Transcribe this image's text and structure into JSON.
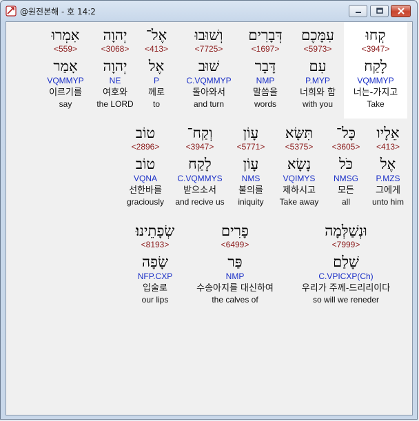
{
  "window": {
    "title": "@원전본해 - 호 14:2"
  },
  "rows": [
    [
      {
        "heb": "קְחוּ",
        "strong": "<3947>",
        "lemma": "לָקַח",
        "parse": "VQMMYP",
        "korean": "너는-가지고",
        "english": "Take",
        "selected": true
      },
      {
        "heb": "עִמָּכֶם",
        "strong": "<5973>",
        "lemma": "עִם",
        "parse": "P.MYP",
        "korean": "너희와 함",
        "english": "with you"
      },
      {
        "heb": "דְּבָרִים",
        "strong": "<1697>",
        "lemma": "דָּבָר",
        "parse": "NMP",
        "korean": "말씀을",
        "english": "words"
      },
      {
        "heb": "וְשׁוּבוּ",
        "strong": "<7725>",
        "lemma": "שׁוּב",
        "parse": "C.VQMMYP",
        "korean": "돌아와서",
        "english": "and turn"
      },
      {
        "heb": "אֶל־",
        "strong": "<413>",
        "lemma": "אֶל",
        "parse": "P",
        "korean": "께로",
        "english": "to"
      },
      {
        "heb": "יְהוָה",
        "strong": "<3068>",
        "lemma": "יְהוָה",
        "parse": "NE",
        "korean": "여호와",
        "english": "the LORD"
      },
      {
        "heb": "אִמְרוּ",
        "strong": "<559>",
        "lemma": "אָמַר",
        "parse": "VQMMYP",
        "korean": "이르기를",
        "english": "say"
      }
    ],
    [
      {
        "heb": "אֵלָיו",
        "strong": "<413>",
        "lemma": "אֶל",
        "parse": "P.MZS",
        "korean": "그에게",
        "english": "unto him"
      },
      {
        "heb": "כָּל־",
        "strong": "<3605>",
        "lemma": "כֹּל",
        "parse": "NMSG",
        "korean": "모든",
        "english": "all"
      },
      {
        "heb": "תִּשָּׂא",
        "strong": "<5375>",
        "lemma": "נָשָׂא",
        "parse": "VQIMYS",
        "korean": "제하시고",
        "english": "Take away"
      },
      {
        "heb": "עָוֹן",
        "strong": "<5771>",
        "lemma": "עָוֹן",
        "parse": "NMS",
        "korean": "불의를",
        "english": "iniquity"
      },
      {
        "heb": "וְקַח־",
        "strong": "<3947>",
        "lemma": "לָקַח",
        "parse": "C.VQMMYS",
        "korean": "받으소서",
        "english": "and recive us"
      },
      {
        "heb": "טוֹב",
        "strong": "<2896>",
        "lemma": "טוֹב",
        "parse": "VQNA",
        "korean": "선한바를",
        "english": "graciously"
      }
    ],
    [
      {
        "heb": "וּנְשַׁלְּמָה",
        "strong": "<7999>",
        "lemma": "שָׁלַם",
        "parse": "C.VPICXP(Ch)",
        "korean": "우리가 주께-드리리이다",
        "english": "so will we reneder"
      },
      {
        "heb": "פָרִים",
        "strong": "<6499>",
        "lemma": "פַּר",
        "parse": "NMP",
        "korean": "수송아지를 대신하여",
        "english": "the calves of"
      },
      {
        "heb": "שְׂפָתֵינוּ׃",
        "strong": "<8193>",
        "lemma": "שָׂפָה",
        "parse": "NFP.CXP",
        "korean": "입술로",
        "english": "our lips"
      }
    ]
  ]
}
